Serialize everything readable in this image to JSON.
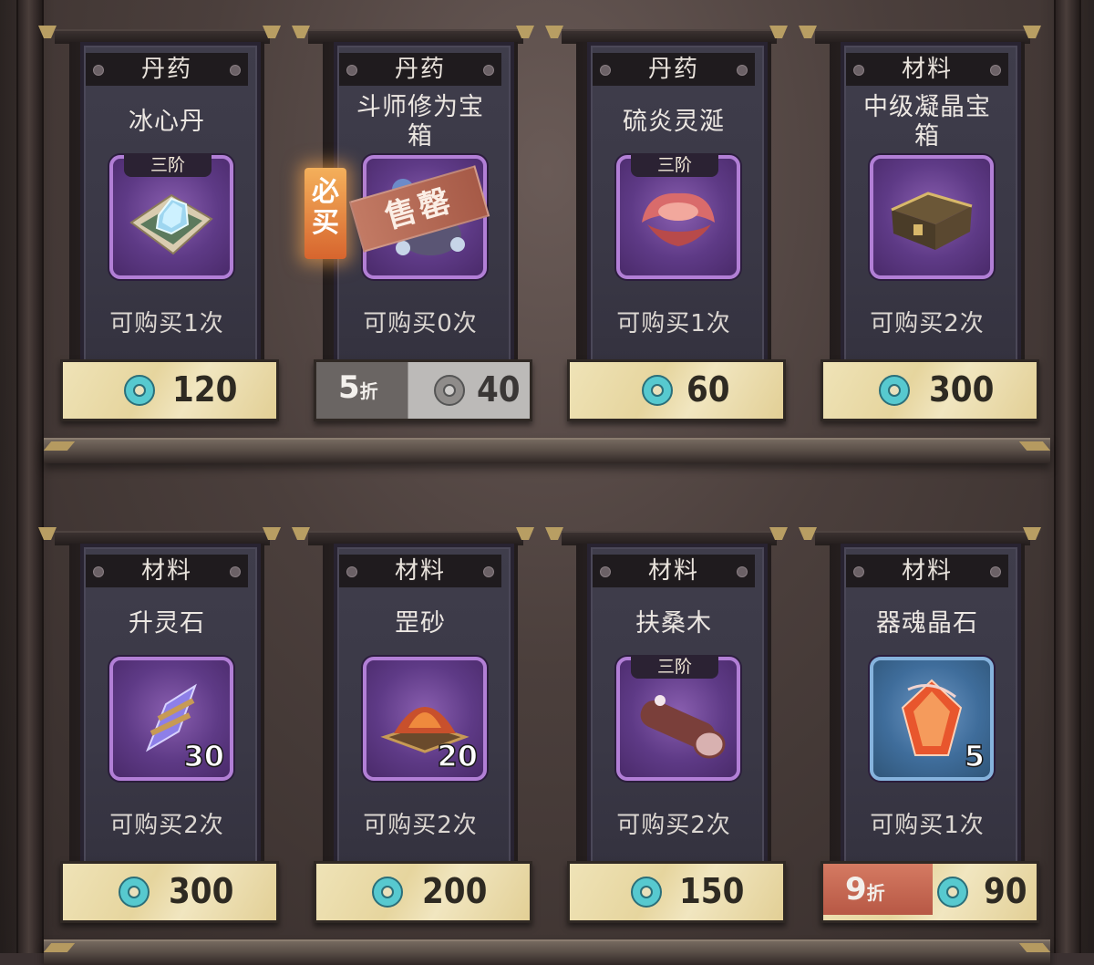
{
  "shop": {
    "items": [
      {
        "category": "丹药",
        "name": "冰心丹",
        "tier": "三阶",
        "limit": "可购买1次",
        "price": "120",
        "icon": "ice-pill-icon"
      },
      {
        "category": "丹药",
        "name": "斗师修为宝箱",
        "tier": "",
        "limit": "可购买0次",
        "price": "40",
        "discount": "5",
        "discount_unit": "折",
        "status": "售罄",
        "badge": "必买",
        "icon": "cultivation-chest-icon"
      },
      {
        "category": "丹药",
        "name": "硫炎灵涎",
        "tier": "三阶",
        "limit": "可购买1次",
        "price": "60",
        "icon": "flame-fungus-icon"
      },
      {
        "category": "材料",
        "name": "中级凝晶宝箱",
        "tier": "",
        "limit": "可购买2次",
        "price": "300",
        "icon": "crystal-chest-icon"
      },
      {
        "category": "材料",
        "name": "升灵石",
        "tier": "",
        "qty": "30",
        "limit": "可购买2次",
        "price": "300",
        "icon": "spirit-stone-icon"
      },
      {
        "category": "材料",
        "name": "罡砂",
        "tier": "",
        "qty": "20",
        "limit": "可购买2次",
        "price": "200",
        "icon": "gang-sand-icon"
      },
      {
        "category": "材料",
        "name": "扶桑木",
        "tier": "三阶",
        "limit": "可购买2次",
        "price": "150",
        "icon": "fusang-wood-icon"
      },
      {
        "category": "材料",
        "name": "器魂晶石",
        "tier": "",
        "qty": "5",
        "limit": "可购买1次",
        "price": "90",
        "discount": "9",
        "discount_unit": "折",
        "icon": "soul-crystal-icon"
      }
    ]
  },
  "colors": {
    "background": "#4b3f3c",
    "card_panel": "#3a3846",
    "icon_purple": "#5e3a86",
    "icon_blue": "#3f6d9b",
    "price_gold": "#e6d59e",
    "discount_red": "#b75845",
    "coin_teal": "#57c9cf"
  }
}
